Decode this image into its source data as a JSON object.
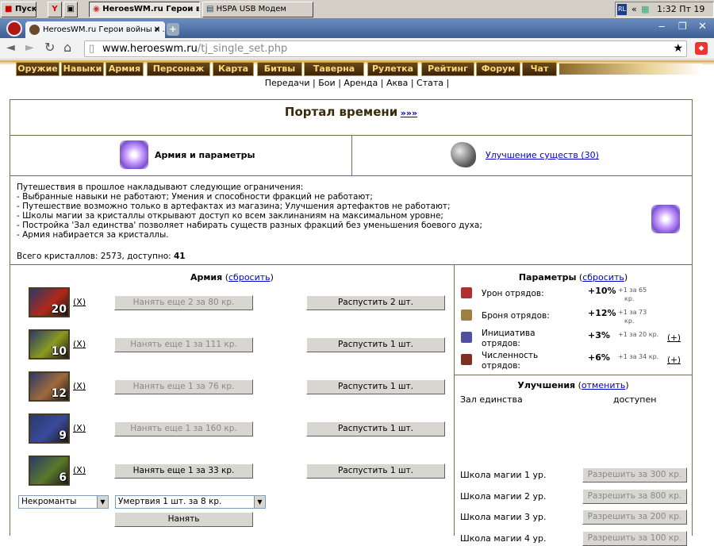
{
  "taskbar": {
    "start": "Пуск",
    "task1": "HeroesWM.ru Герои в...",
    "task2": "HSPA USB Модем",
    "lang": "RL",
    "clock": "1:32 Пт 19"
  },
  "browser": {
    "tab_title": "HeroesWM.ru Герои войны и ...",
    "url_host": "www.heroeswm.ru",
    "url_path": "/tj_single_set.php"
  },
  "menu": [
    "Оружие",
    "Навыки",
    "Армия",
    "Персонаж",
    "Карта",
    "Битвы",
    "Таверна",
    "Рулетка",
    "Рейтинг",
    "Форум",
    "Чат"
  ],
  "submenu": [
    "Передачи",
    "Бои",
    "Аренда",
    "Аква",
    "Стата"
  ],
  "portal": {
    "title": "Портал времени",
    "title_link": "»»»",
    "tab_army": "Армия и параметры",
    "tab_upgrade": "Улучшение существ (30)"
  },
  "info": {
    "lines": [
      "Путешествия в прошлое накладывают следующие ограничения:",
      "- Выбранные навыки не работают; Умения и способности фракций не работают;",
      "- Путешествие возможно только в артефактах из магазина; Улучшения артефактов не работают;",
      "- Школы магии за кристаллы открывают доступ ко всем заклинаниям на максимальном уровне;",
      "- Постройка 'Зал единства' позволяет набирать существ разных фракций без уменьшения боевого духа;",
      "- Армия набирается за кристаллы."
    ],
    "total_label": "Всего кристаллов: 2573, доступно:",
    "available": "41"
  },
  "army": {
    "title": "Армия",
    "reset": "сбросить",
    "x_label": "(X)",
    "units": [
      {
        "count": "20",
        "hire": "Нанять еще 2 за 80 кр.",
        "dismiss": "Распустить 2 шт.",
        "enabled": false,
        "color": "#b02818"
      },
      {
        "count": "10",
        "hire": "Нанять еще 1 за 111 кр.",
        "dismiss": "Распустить 1 шт.",
        "enabled": false,
        "color": "#8a9a20"
      },
      {
        "count": "12",
        "hire": "Нанять еще 1 за 76 кр.",
        "dismiss": "Распустить 1 шт.",
        "enabled": false,
        "color": "#a06a3a"
      },
      {
        "count": "9",
        "hire": "Нанять еще 1 за 160 кр.",
        "dismiss": "Распустить 1 шт.",
        "enabled": false,
        "color": "#3a4a9a"
      },
      {
        "count": "6",
        "hire": "Нанять еще 1 за 33 кр.",
        "dismiss": "Распустить 1 шт.",
        "enabled": true,
        "color": "#5a7a2a"
      }
    ],
    "faction": "Некроманты",
    "creature": "Умертвия 1 шт. за 8 кр.",
    "hire_btn": "Нанять"
  },
  "params": {
    "title": "Параметры",
    "reset": "сбросить",
    "rows": [
      {
        "l1": "Урон отрядов:",
        "l2": "",
        "val": "+10%",
        "note": "+1 за 65",
        "note2": "кр.",
        "plus": ""
      },
      {
        "l1": "Броня отрядов:",
        "l2": "",
        "val": "+12%",
        "note": "+1 за 73",
        "note2": "кр.",
        "plus": ""
      },
      {
        "l1": "Инициатива",
        "l2": "отрядов:",
        "val": "+3%",
        "note": "+1 за 20 кр.",
        "note2": "",
        "plus": "(+)"
      },
      {
        "l1": "Численность",
        "l2": "отрядов:",
        "val": "+6%",
        "note": "+1 за 34 кр.",
        "note2": "",
        "plus": "(+)"
      }
    ]
  },
  "upgrades": {
    "title": "Улучшения",
    "cancel": "отменить",
    "hall": "Зал единства",
    "hall_status": "доступен",
    "schools": [
      {
        "label": "Школа магии 1 ур.",
        "btn": "Разрешить за 300 кр."
      },
      {
        "label": "Школа магии 2 ур.",
        "btn": "Разрешить за 800 кр."
      },
      {
        "label": "Школа магии 3 ур.",
        "btn": "Разрешить за 200 кр."
      },
      {
        "label": "Школа магии 4 ур.",
        "btn": "Разрешить за 100 кр."
      }
    ]
  }
}
